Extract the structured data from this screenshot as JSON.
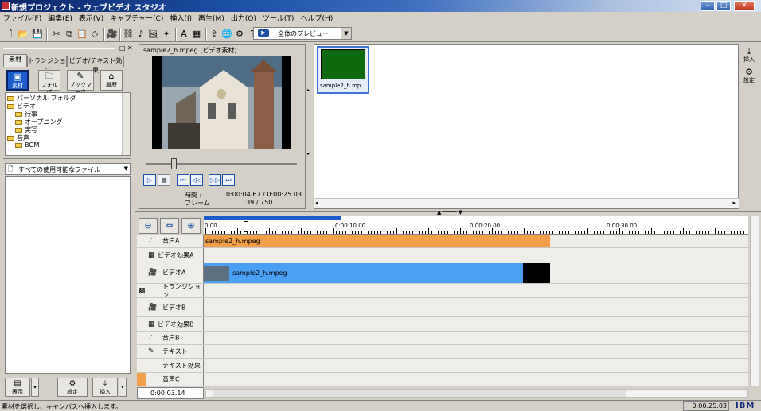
{
  "window": {
    "title": "新規プロジェクト - ウェブビデオ スタジオ"
  },
  "menu": [
    "ファイル(F)",
    "編集(E)",
    "表示(V)",
    "キャプチャー(C)",
    "挿入(I)",
    "再生(M)",
    "出力(O)",
    "ツール(T)",
    "ヘルプ(H)"
  ],
  "toolbar": {
    "preview_select": "全体のプレビュー"
  },
  "left": {
    "tabs": [
      "素材",
      "トランジション",
      "ビデオ/テキスト効果"
    ],
    "buttons": [
      "素材",
      "フォルダ",
      "ブックマーク",
      "履歴"
    ],
    "tree": [
      "パーソナル フォルダ",
      "ビデオ",
      "行事",
      "オープニング",
      "実写",
      "音声",
      "BGM"
    ],
    "filter": "すべての使用可能なファイル",
    "bottom_buttons": [
      "表示",
      "設定",
      "挿入"
    ]
  },
  "preview": {
    "title": "sample2_h.mpeg (ビデオ素材)",
    "time_label": "時間 :",
    "time_value": "0:00:04.67  /  0:00:25.03",
    "frame_label": "フレーム :",
    "frame_value": "139  /  750"
  },
  "canvas": {
    "thumb_label": "sample2_h.mp...",
    "side_buttons": [
      "挿入",
      "設定"
    ]
  },
  "timeline": {
    "ruler": [
      "0:00",
      "0:00:10.00",
      "0:00:20.00",
      "0:00:30.00"
    ],
    "rows": [
      "音声A",
      "ビデオ効果A",
      "ビデオA",
      "トランジション",
      "ビデオB",
      "ビデオ効果B",
      "音声B",
      "テキスト",
      "テキスト効果",
      "音声C"
    ],
    "clip_audio": "sample2_h.mpeg",
    "clip_video": "sample2_h.mpeg",
    "current_time": "0:00:03.14"
  },
  "status": {
    "message": "素材を選択し、キャンバスへ挿入します。",
    "total_time": "0:00:25.03",
    "brand": "IBM"
  },
  "colors": {
    "audio_clip": "#f4a04a",
    "video_clip": "#4aa0f4",
    "selection": "#1c5ccc",
    "titlebar": "#0a2468"
  }
}
